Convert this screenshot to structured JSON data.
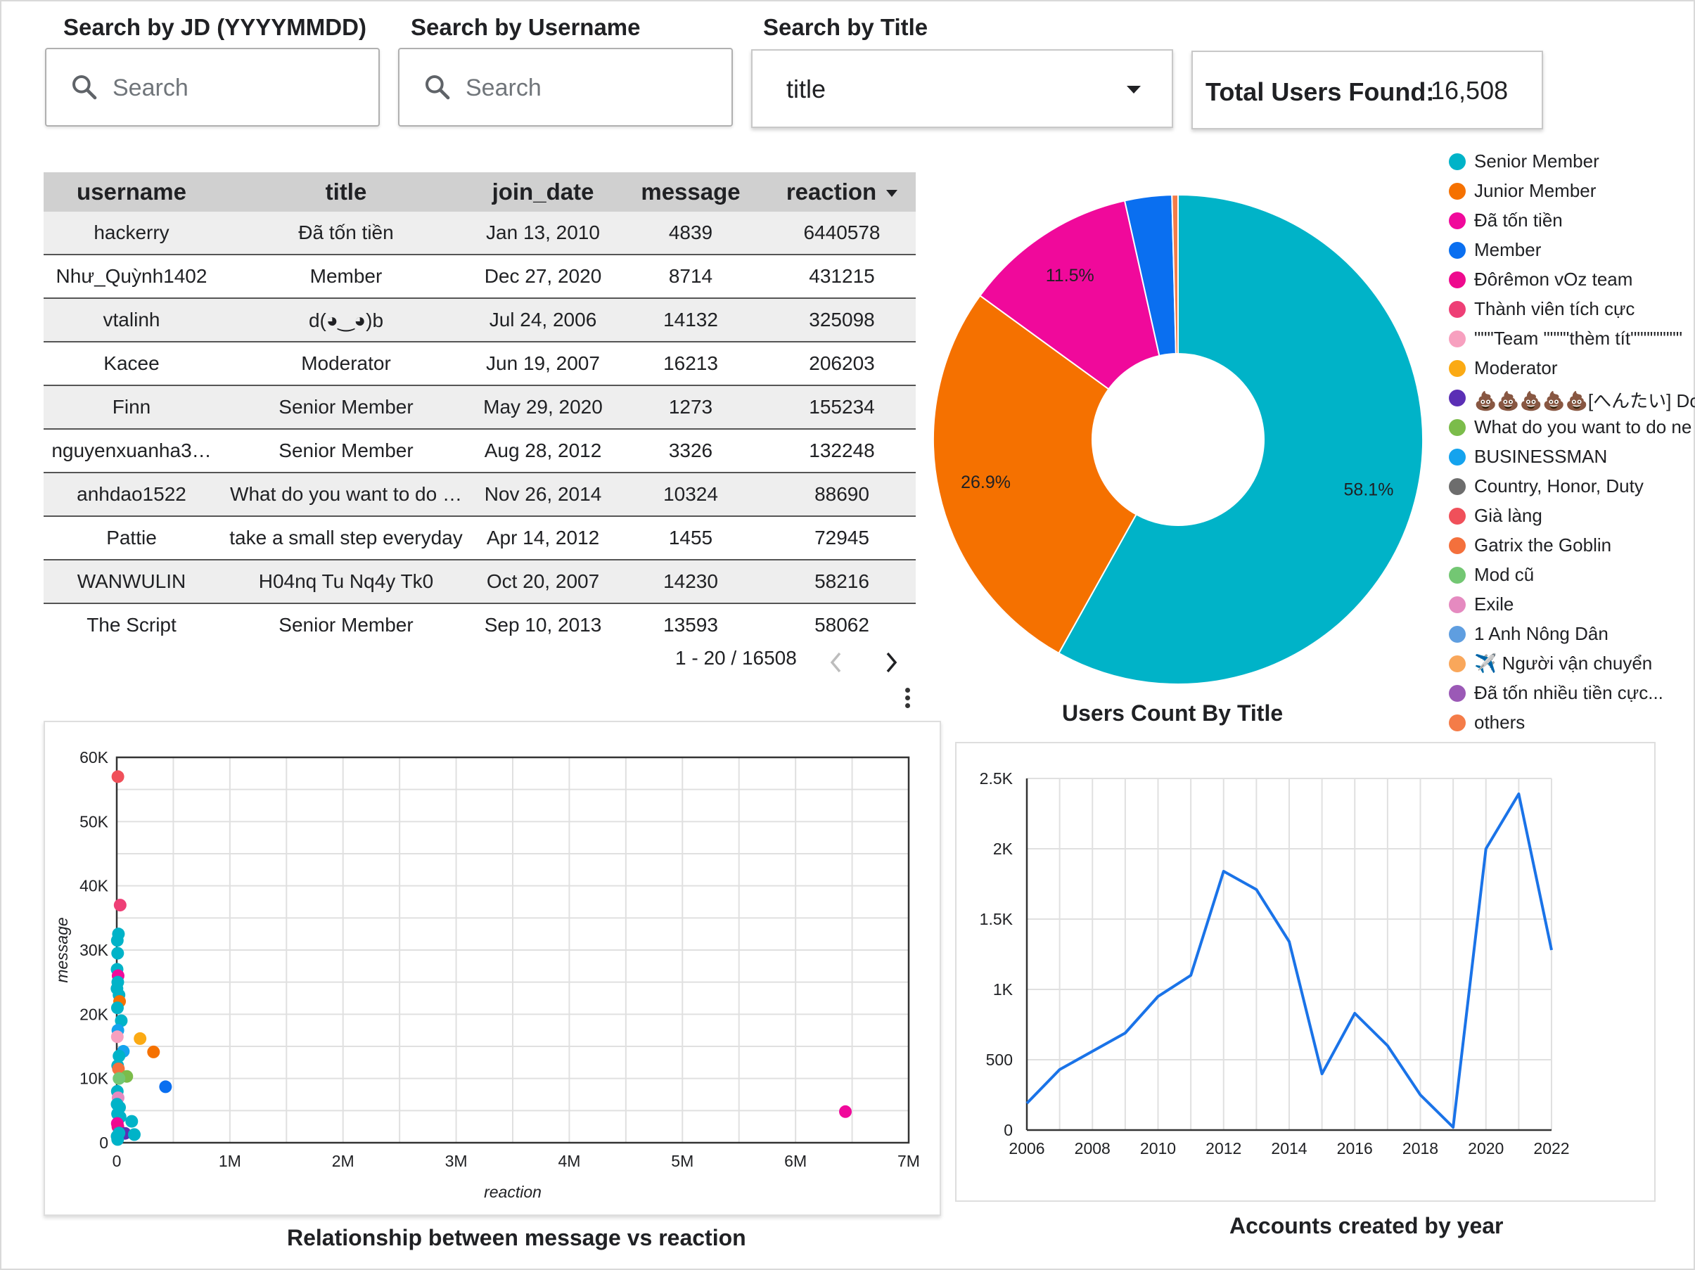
{
  "filters": {
    "jd_label": "Search by JD (YYYYMMDD)",
    "username_label": "Search by Username",
    "title_label": "Search by Title",
    "search_placeholder": "Search",
    "title_value": "title"
  },
  "scorecard": {
    "label": "Total Users Found:",
    "value": "16,508"
  },
  "table": {
    "columns": [
      "username",
      "title",
      "join_date",
      "message",
      "reaction"
    ],
    "rows": [
      [
        "hackerry",
        "Đã tốn tiền",
        "Jan 13, 2010",
        "4839",
        "6440578"
      ],
      [
        "Như_Quỳnh1402",
        "Member",
        "Dec 27, 2020",
        "8714",
        "431215"
      ],
      [
        "vtalinh",
        "d(◕‿◕)b",
        "Jul 24, 2006",
        "14132",
        "325098"
      ],
      [
        "Kacee",
        "Moderator",
        "Jun 19, 2007",
        "16213",
        "206203"
      ],
      [
        "Finn",
        "Senior Member",
        "May 29, 2020",
        "1273",
        "155234"
      ],
      [
        "nguyenxuanha3…",
        "Senior Member",
        "Aug 28, 2012",
        "3326",
        "132248"
      ],
      [
        "anhdao1522",
        "What do you want to do …",
        "Nov 26, 2014",
        "10324",
        "88690"
      ],
      [
        "Pattie",
        "take a small step everyday",
        "Apr 14, 2012",
        "1455",
        "72945"
      ],
      [
        "WANWULIN",
        "H04nq Tu Nq4y Tk0",
        "Oct 20, 2007",
        "14230",
        "58216"
      ],
      [
        "The Script",
        "Senior Member",
        "Sep 10, 2013",
        "13593",
        "58062"
      ]
    ],
    "pagination": "1 - 20 / 16508"
  },
  "legend": [
    {
      "label": "Senior Member",
      "color": "#00b3c8"
    },
    {
      "label": "Junior Member",
      "color": "#f57100"
    },
    {
      "label": "Đã tốn tiền",
      "color": "#f0099b"
    },
    {
      "label": "Member",
      "color": "#0a6ff0"
    },
    {
      "label": "Đôrêmon vOz team",
      "color": "#ee0a8e"
    },
    {
      "label": "Thành viên tích cực",
      "color": "#ee3f76"
    },
    {
      "label": "\"\"\"Team \"\"\"\"thèm tít\"\"\"\"\"\"\"\"",
      "color": "#f7a0bf"
    },
    {
      "label": "Moderator",
      "color": "#fbaa14"
    },
    {
      "label": "💩💩💩💩💩[へんたい] Dora",
      "color": "#5b2fb5"
    },
    {
      "label": "What do you want to do ne",
      "color": "#7bbc4a"
    },
    {
      "label": "BUSINESSMAN",
      "color": "#14a3ee"
    },
    {
      "label": "Country, Honor, Duty",
      "color": "#6d6d6d"
    },
    {
      "label": "Già làng",
      "color": "#f0505a"
    },
    {
      "label": "Gatrix the Goblin",
      "color": "#f4703c"
    },
    {
      "label": "Mod cũ",
      "color": "#73c773"
    },
    {
      "label": "Exile",
      "color": "#e58ac0"
    },
    {
      "label": "1 Anh Nông Dân",
      "color": "#5f9ee0"
    },
    {
      "label": "✈️ Người vận chuyển",
      "color": "#f9a75b"
    },
    {
      "label": "Đã tốn nhiều tiền cực...",
      "color": "#9b59b6"
    },
    {
      "label": "others",
      "color": "#f47c48"
    }
  ],
  "chart_data": [
    {
      "type": "pie",
      "title": "Users Count By Title",
      "donut": true,
      "slices": [
        {
          "label": "Senior Member",
          "value": 58.1,
          "color": "#00b3c8",
          "show_label": "58.1%"
        },
        {
          "label": "Junior Member",
          "value": 26.9,
          "color": "#f57100",
          "show_label": "26.9%"
        },
        {
          "label": "Đã tốn tiền",
          "value": 11.5,
          "color": "#f0099b",
          "show_label": "11.5%"
        },
        {
          "label": "Member",
          "value": 3.1,
          "color": "#0a6ff0",
          "show_label": ""
        },
        {
          "label": "others",
          "value": 0.4,
          "color": "#f47c48",
          "show_label": ""
        }
      ]
    },
    {
      "type": "scatter",
      "title": "Relationship between message vs reaction",
      "xlabel": "reaction",
      "ylabel": "message",
      "xlim": [
        0,
        7000000
      ],
      "ylim": [
        0,
        60000
      ],
      "x_ticks": [
        "0",
        "1M",
        "2M",
        "3M",
        "4M",
        "5M",
        "6M",
        "7M"
      ],
      "y_ticks": [
        "0",
        "10K",
        "20K",
        "30K",
        "40K",
        "50K",
        "60K"
      ],
      "grid": true,
      "points": [
        {
          "x": 10000,
          "y": 57000,
          "color": "#f0505a"
        },
        {
          "x": 30000,
          "y": 37000,
          "color": "#ee3f76"
        },
        {
          "x": 15000,
          "y": 32500,
          "color": "#00b3c8"
        },
        {
          "x": 5000,
          "y": 31500,
          "color": "#00b3c8"
        },
        {
          "x": 8000,
          "y": 29500,
          "color": "#00b3c8"
        },
        {
          "x": 3000,
          "y": 27000,
          "color": "#00b3c8"
        },
        {
          "x": 12000,
          "y": 26000,
          "color": "#f0099b"
        },
        {
          "x": 9000,
          "y": 25000,
          "color": "#00b3c8"
        },
        {
          "x": 2000,
          "y": 24000,
          "color": "#00b3c8"
        },
        {
          "x": 20000,
          "y": 23000,
          "color": "#00b3c8"
        },
        {
          "x": 25000,
          "y": 22000,
          "color": "#f57100"
        },
        {
          "x": 6000,
          "y": 21000,
          "color": "#00b3c8"
        },
        {
          "x": 40000,
          "y": 19000,
          "color": "#00b3c8"
        },
        {
          "x": 10000,
          "y": 17500,
          "color": "#14a3ee"
        },
        {
          "x": 5000,
          "y": 16500,
          "color": "#f7a0bf"
        },
        {
          "x": 206203,
          "y": 16213,
          "color": "#fbaa14"
        },
        {
          "x": 325098,
          "y": 14132,
          "color": "#f57100"
        },
        {
          "x": 58216,
          "y": 14230,
          "color": "#14a3ee"
        },
        {
          "x": 20000,
          "y": 13500,
          "color": "#00b3c8"
        },
        {
          "x": 8000,
          "y": 12000,
          "color": "#00b3c8"
        },
        {
          "x": 15000,
          "y": 11500,
          "color": "#f4703c"
        },
        {
          "x": 88690,
          "y": 10324,
          "color": "#7bbc4a"
        },
        {
          "x": 20000,
          "y": 10000,
          "color": "#73c773"
        },
        {
          "x": 431215,
          "y": 8714,
          "color": "#0a6ff0"
        },
        {
          "x": 5000,
          "y": 8000,
          "color": "#00b3c8"
        },
        {
          "x": 12000,
          "y": 7000,
          "color": "#e58ac0"
        },
        {
          "x": 3000,
          "y": 6000,
          "color": "#00b3c8"
        },
        {
          "x": 25000,
          "y": 5500,
          "color": "#00b3c8"
        },
        {
          "x": 7000,
          "y": 4500,
          "color": "#00b3c8"
        },
        {
          "x": 30000,
          "y": 4000,
          "color": "#00b3c8"
        },
        {
          "x": 132248,
          "y": 3326,
          "color": "#00b3c8"
        },
        {
          "x": 5000,
          "y": 3000,
          "color": "#f0099b"
        },
        {
          "x": 10000,
          "y": 2500,
          "color": "#ee0a8e"
        },
        {
          "x": 72945,
          "y": 1455,
          "color": "#5b2fb5"
        },
        {
          "x": 155234,
          "y": 1273,
          "color": "#00b3c8"
        },
        {
          "x": 20000,
          "y": 1500,
          "color": "#00b3c8"
        },
        {
          "x": 3000,
          "y": 1000,
          "color": "#00b3c8"
        },
        {
          "x": 8000,
          "y": 500,
          "color": "#00b3c8"
        },
        {
          "x": 6440578,
          "y": 4839,
          "color": "#f0099b"
        }
      ]
    },
    {
      "type": "line",
      "title": "Accounts created by year",
      "xlim": [
        2006,
        2022
      ],
      "ylim": [
        0,
        2500
      ],
      "x_ticks": [
        "2006",
        "2008",
        "2010",
        "2012",
        "2014",
        "2016",
        "2018",
        "2020",
        "2022"
      ],
      "y_ticks": [
        "0",
        "500",
        "1K",
        "1.5K",
        "2K",
        "2.5K"
      ],
      "grid": true,
      "series": [
        {
          "color": "#1a73e8",
          "x": [
            2006,
            2007,
            2008,
            2009,
            2010,
            2011,
            2012,
            2013,
            2014,
            2015,
            2016,
            2017,
            2018,
            2019,
            2020,
            2021,
            2022
          ],
          "values": [
            190,
            430,
            560,
            690,
            950,
            1100,
            1840,
            1710,
            1340,
            400,
            830,
            600,
            250,
            20,
            2000,
            2390,
            1280
          ]
        }
      ]
    }
  ]
}
